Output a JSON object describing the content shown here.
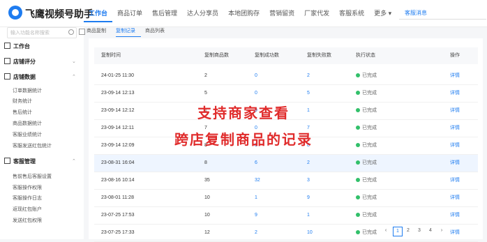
{
  "app": {
    "title": "飞鹰视频号助手"
  },
  "nav": {
    "items": [
      "工作台",
      "商品订单",
      "售后管理",
      "达人分享员",
      "本地团购存",
      "营销留资",
      "厂家代发",
      "客服系统",
      "更多 ▾"
    ],
    "notice": "客服消息"
  },
  "sidebar": {
    "search_placeholder": "输入功能名称搜索",
    "groups": [
      {
        "label": "工作台",
        "icon": "home-icon",
        "items": []
      },
      {
        "label": "店铺评分",
        "icon": "rating-icon",
        "items": []
      },
      {
        "label": "店铺数据",
        "icon": "data-icon",
        "items": [
          "订单数据统计",
          "财务统计",
          "售后统计",
          "商品数据统计",
          "客服业绩统计",
          "客服发送红包统计"
        ]
      },
      {
        "label": "客服管理",
        "icon": "service-icon",
        "items": [
          "售前售后客服设置",
          "客服操作权限",
          "客服操作日志",
          "返现红包账户",
          "发送红包权限"
        ]
      }
    ]
  },
  "tabs": [
    "商品复制",
    "复制记录",
    "商品列表"
  ],
  "table": {
    "headers": [
      "复制时间",
      "复制商品数",
      "复制成功数",
      "复制失败数",
      "执行状态",
      "操作"
    ],
    "rows": [
      {
        "time": "24-01-25 11:30",
        "total": "2",
        "success": "0",
        "fail": "2",
        "status": "已完成",
        "action": "详情"
      },
      {
        "time": "23-09-14 12:13",
        "total": "5",
        "success": "0",
        "fail": "5",
        "status": "已完成",
        "action": "详情"
      },
      {
        "time": "23-09-14 12:12",
        "total": "1",
        "success": "0",
        "fail": "1",
        "status": "已完成",
        "action": "详情"
      },
      {
        "time": "23-09-14 12:11",
        "total": "7",
        "success": "0",
        "fail": "7",
        "status": "已完成",
        "action": "详情"
      },
      {
        "time": "23-09-14 12:09",
        "total": "8",
        "success": "0",
        "fail": "8",
        "status": "已完成",
        "action": "详情"
      },
      {
        "time": "23-08-31 16:04",
        "total": "8",
        "success": "6",
        "fail": "2",
        "status": "已完成",
        "action": "详情"
      },
      {
        "time": "23-08-16 10:14",
        "total": "35",
        "success": "32",
        "fail": "3",
        "status": "已完成",
        "action": "详情"
      },
      {
        "time": "23-08-01 11:28",
        "total": "10",
        "success": "1",
        "fail": "9",
        "status": "已完成",
        "action": "详情"
      },
      {
        "time": "23-07-25 17:53",
        "total": "10",
        "success": "9",
        "fail": "1",
        "status": "已完成",
        "action": "详情"
      },
      {
        "time": "23-07-25 17:33",
        "total": "12",
        "success": "2",
        "fail": "10",
        "status": "已完成",
        "action": "详情"
      }
    ]
  },
  "overlay": {
    "line1": "支持商家查看",
    "line2": "跨店复制商品的记录"
  },
  "pager": {
    "pages": [
      "1",
      "2",
      "3",
      "4"
    ]
  },
  "colors": {
    "accent": "#1e7cf0",
    "success": "#32c06a",
    "overlay": "#e02b2b"
  }
}
